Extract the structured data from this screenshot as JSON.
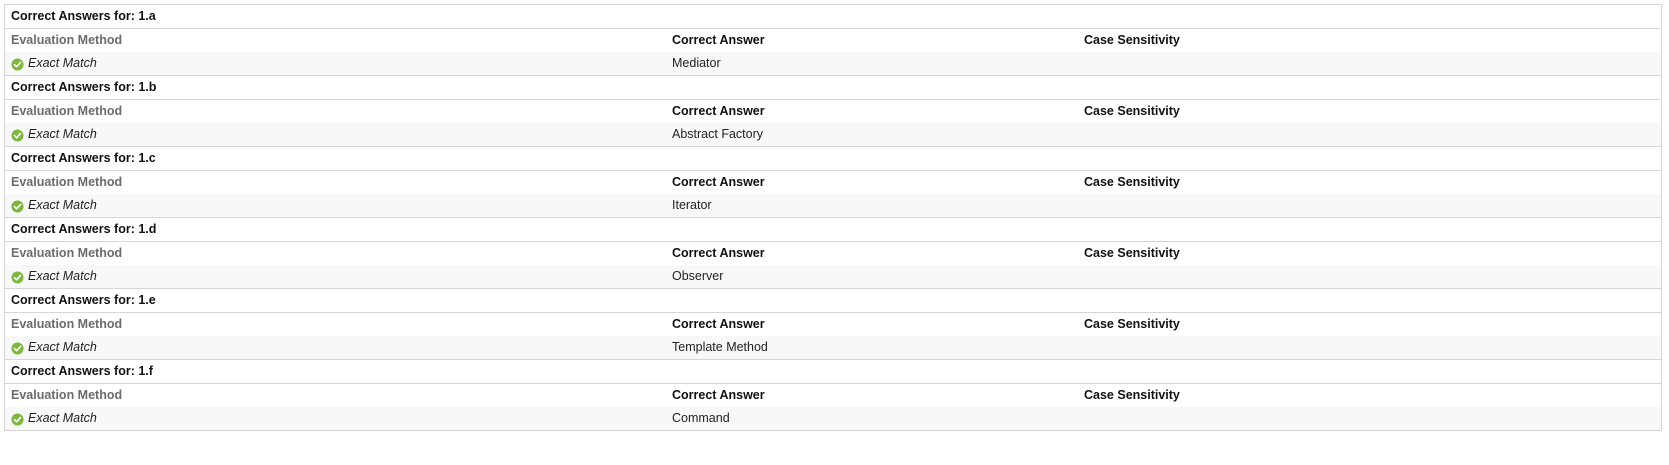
{
  "header_labels": {
    "title_prefix": "Correct Answers for:",
    "evaluation_method": "Evaluation Method",
    "correct_answer": "Correct Answer",
    "case_sensitivity": "Case Sensitivity"
  },
  "colors": {
    "check_green": "#7cb83a",
    "border": "#d6d6d6",
    "value_row_bg": "#f8f8f8"
  },
  "sections": [
    {
      "title": "Correct Answers for: 1.a",
      "method": "Exact Match",
      "answer": "Mediator",
      "case_sensitivity": ""
    },
    {
      "title": "Correct Answers for: 1.b",
      "method": "Exact Match",
      "answer": "Abstract Factory",
      "case_sensitivity": ""
    },
    {
      "title": "Correct Answers for: 1.c",
      "method": "Exact Match",
      "answer": "Iterator",
      "case_sensitivity": ""
    },
    {
      "title": "Correct Answers for: 1.d",
      "method": "Exact Match",
      "answer": "Observer",
      "case_sensitivity": ""
    },
    {
      "title": "Correct Answers for: 1.e",
      "method": "Exact Match",
      "answer": "Template Method",
      "case_sensitivity": ""
    },
    {
      "title": "Correct Answers for: 1.f",
      "method": "Exact Match",
      "answer": "Command",
      "case_sensitivity": ""
    }
  ]
}
